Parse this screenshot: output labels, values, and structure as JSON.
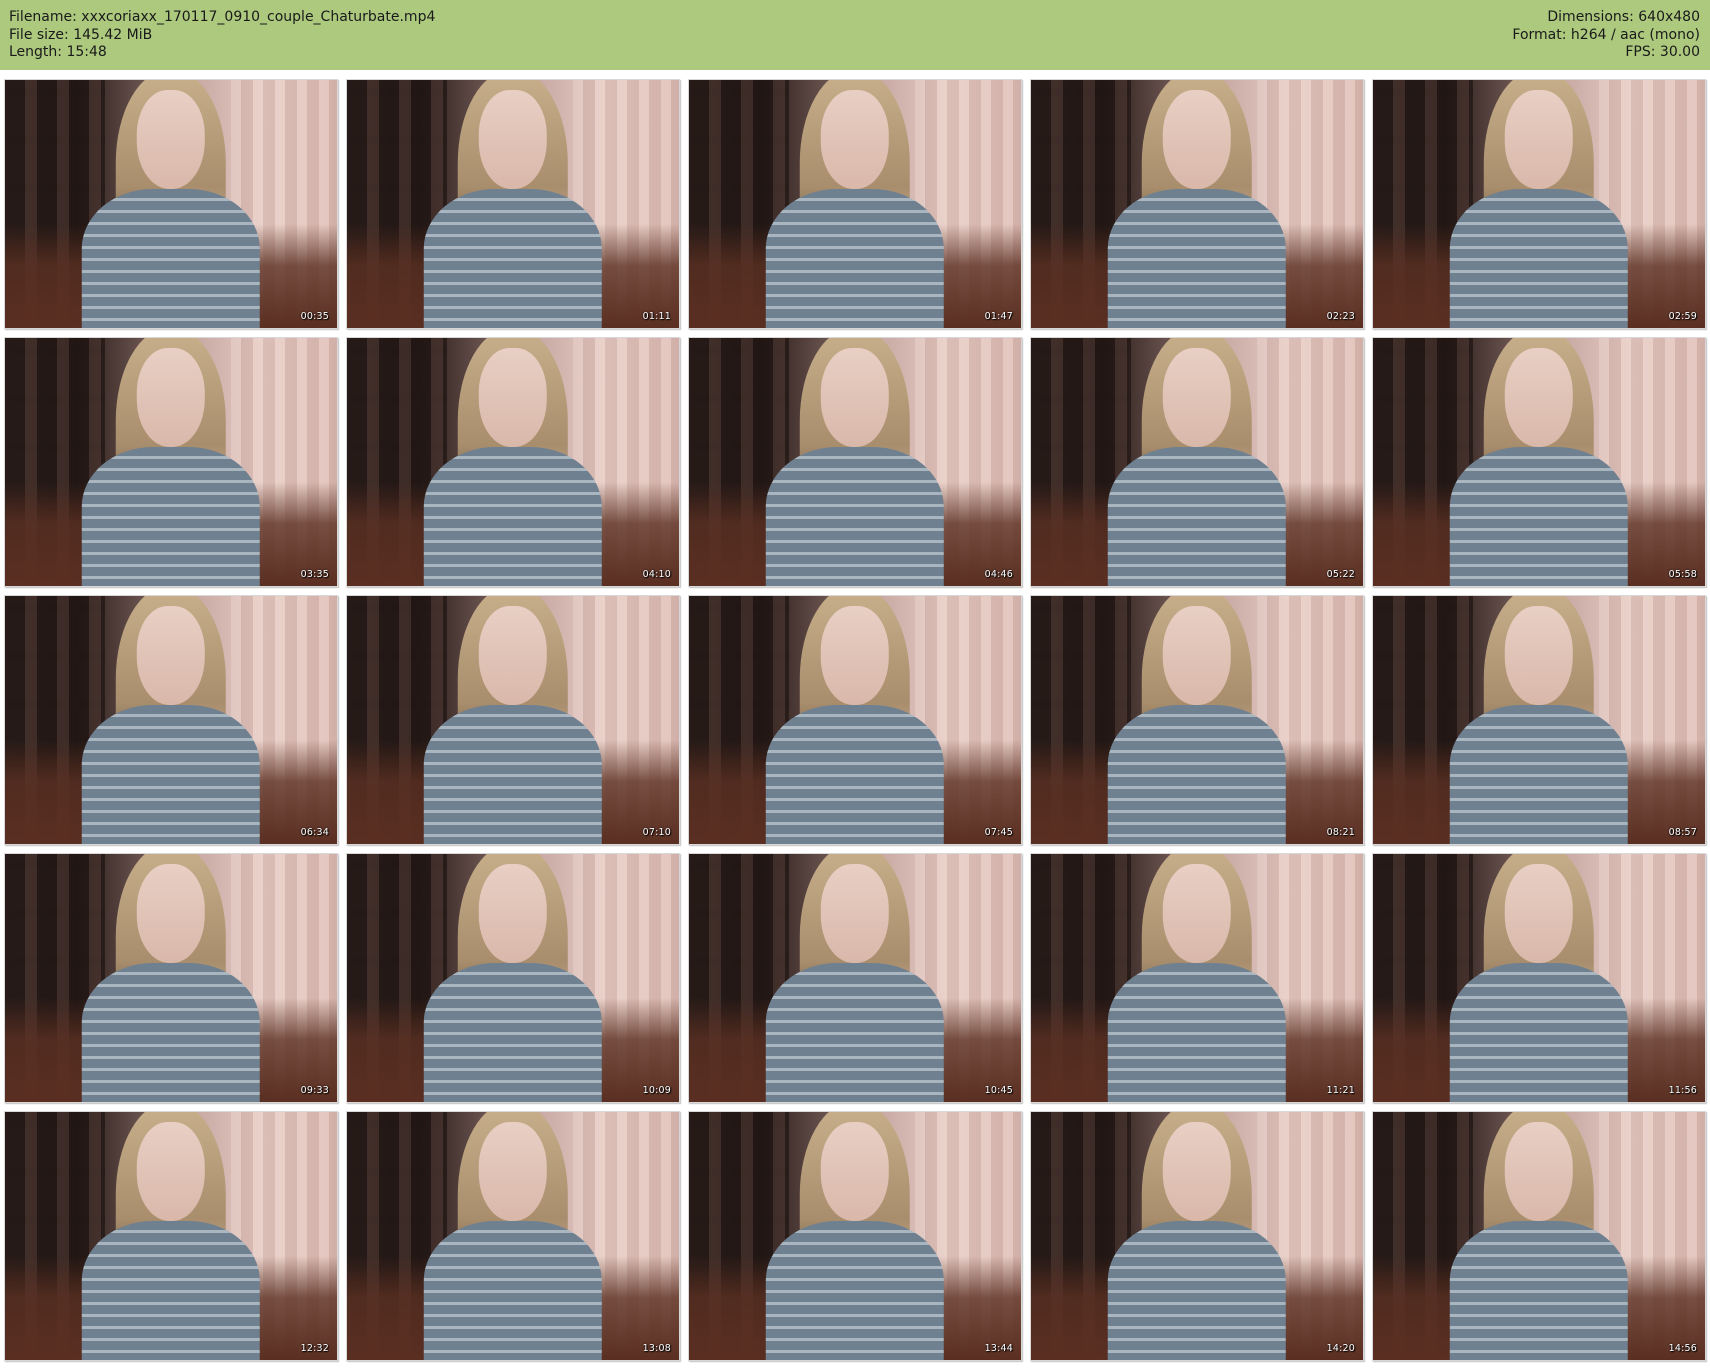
{
  "header": {
    "filename": "Filename: xxxcoriaxx_170117_0910_couple_Chaturbate.mp4",
    "file_size": "File size: 145.42 MiB",
    "length": "Length: 15:48",
    "dimensions": "Dimensions: 640x480",
    "format": "Format: h264 / aac (mono)",
    "fps": "FPS: 30.00"
  },
  "colors": {
    "header_bg": "#acc97e",
    "page_bg": "#ffffff",
    "timestamp_text": "#ffffff"
  },
  "thumbnails": [
    {
      "time": "00:35"
    },
    {
      "time": "01:11"
    },
    {
      "time": "01:47"
    },
    {
      "time": "02:23"
    },
    {
      "time": "02:59"
    },
    {
      "time": "03:35"
    },
    {
      "time": "04:10"
    },
    {
      "time": "04:46"
    },
    {
      "time": "05:22"
    },
    {
      "time": "05:58"
    },
    {
      "time": "06:34"
    },
    {
      "time": "07:10"
    },
    {
      "time": "07:45"
    },
    {
      "time": "08:21"
    },
    {
      "time": "08:57"
    },
    {
      "time": "09:33"
    },
    {
      "time": "10:09"
    },
    {
      "time": "10:45"
    },
    {
      "time": "11:21"
    },
    {
      "time": "11:56"
    },
    {
      "time": "12:32"
    },
    {
      "time": "13:08"
    },
    {
      "time": "13:44"
    },
    {
      "time": "14:20"
    },
    {
      "time": "14:56"
    }
  ]
}
